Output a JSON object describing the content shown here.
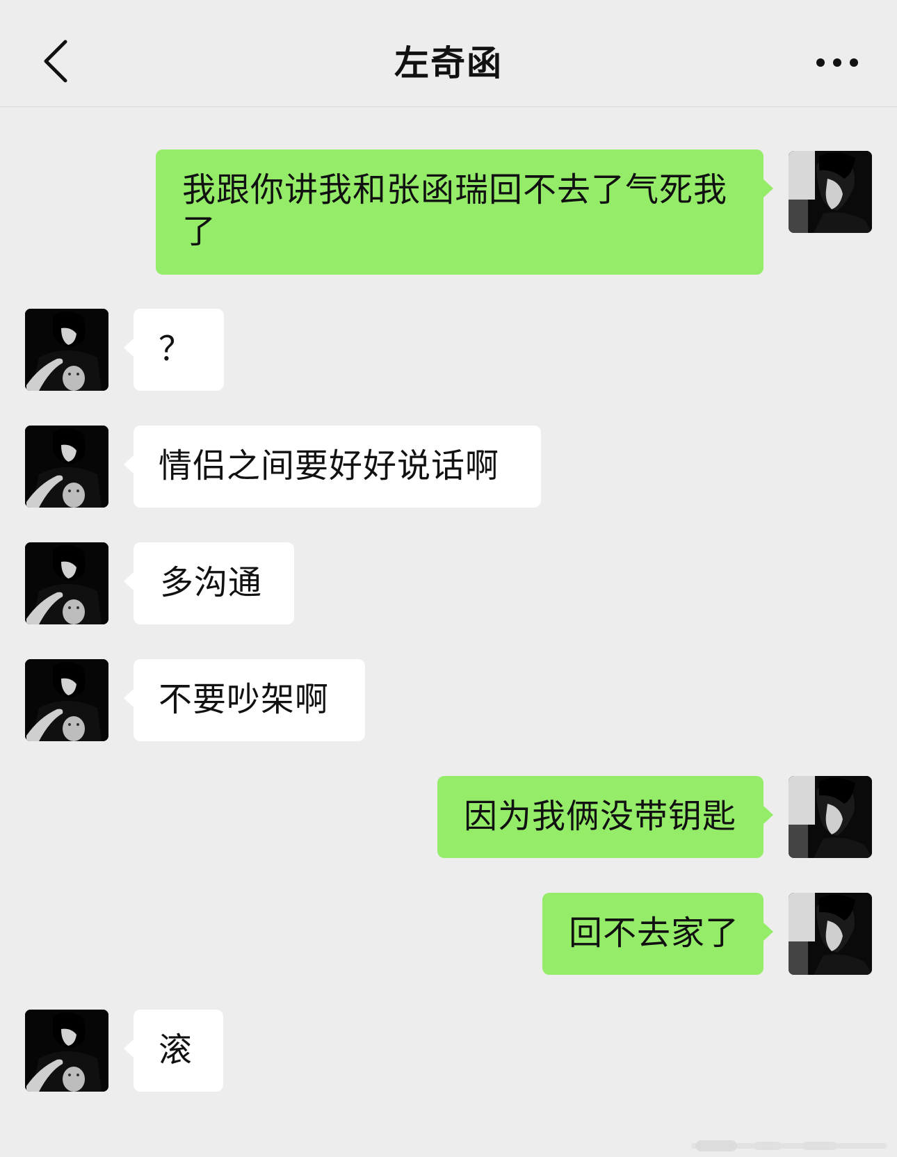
{
  "header": {
    "back_icon": "chevron-left-icon",
    "title": "左奇函",
    "more_icon": "ellipsis-icon"
  },
  "colors": {
    "background": "#ededed",
    "self_bubble": "#95ec69",
    "other_bubble": "#ffffff",
    "text": "#111111"
  },
  "messages": [
    {
      "sender": "self",
      "text": "我跟你讲我和张函瑞回不去了气死我了"
    },
    {
      "sender": "other",
      "text": "？"
    },
    {
      "sender": "other",
      "text": "情侣之间要好好说话啊"
    },
    {
      "sender": "other",
      "text": "多沟通"
    },
    {
      "sender": "other",
      "text": "不要吵架啊"
    },
    {
      "sender": "self",
      "text": "因为我俩没带钥匙"
    },
    {
      "sender": "self",
      "text": "回不去家了"
    },
    {
      "sender": "other",
      "text": "滚"
    }
  ]
}
